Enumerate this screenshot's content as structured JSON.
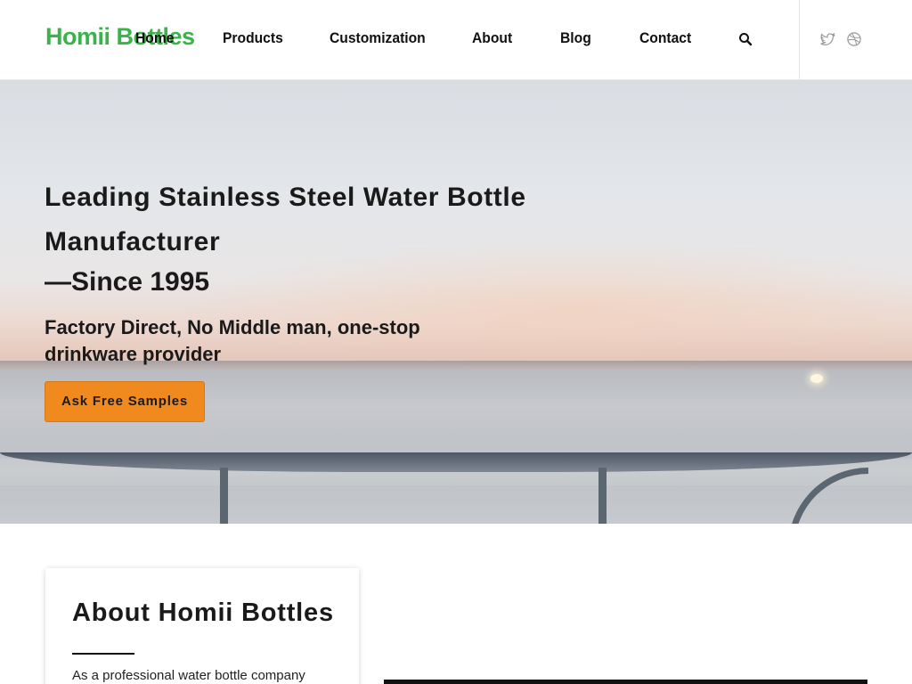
{
  "header": {
    "logo": "Homii Bottles",
    "nav": [
      {
        "label": "Home"
      },
      {
        "label": "Products"
      },
      {
        "label": "Customization"
      },
      {
        "label": "About"
      },
      {
        "label": "Blog"
      },
      {
        "label": "Contact"
      }
    ],
    "search_icon": "search-icon",
    "social": [
      "twitter-icon",
      "dribbble-icon"
    ]
  },
  "hero": {
    "title": "Leading Stainless Steel Water Bottle Manufacturer",
    "since": "—Since 1995",
    "subtitle": "Factory Direct, No Middle man, one-stop drinkware provider",
    "cta_label": "Ask Free Samples"
  },
  "about": {
    "title": "About Homii Bottles",
    "text": "As a professional water bottle company"
  },
  "colors": {
    "logo_green": "#3bb24a",
    "cta_orange": "#f08a1f",
    "text_dark": "#1a1a1a"
  }
}
